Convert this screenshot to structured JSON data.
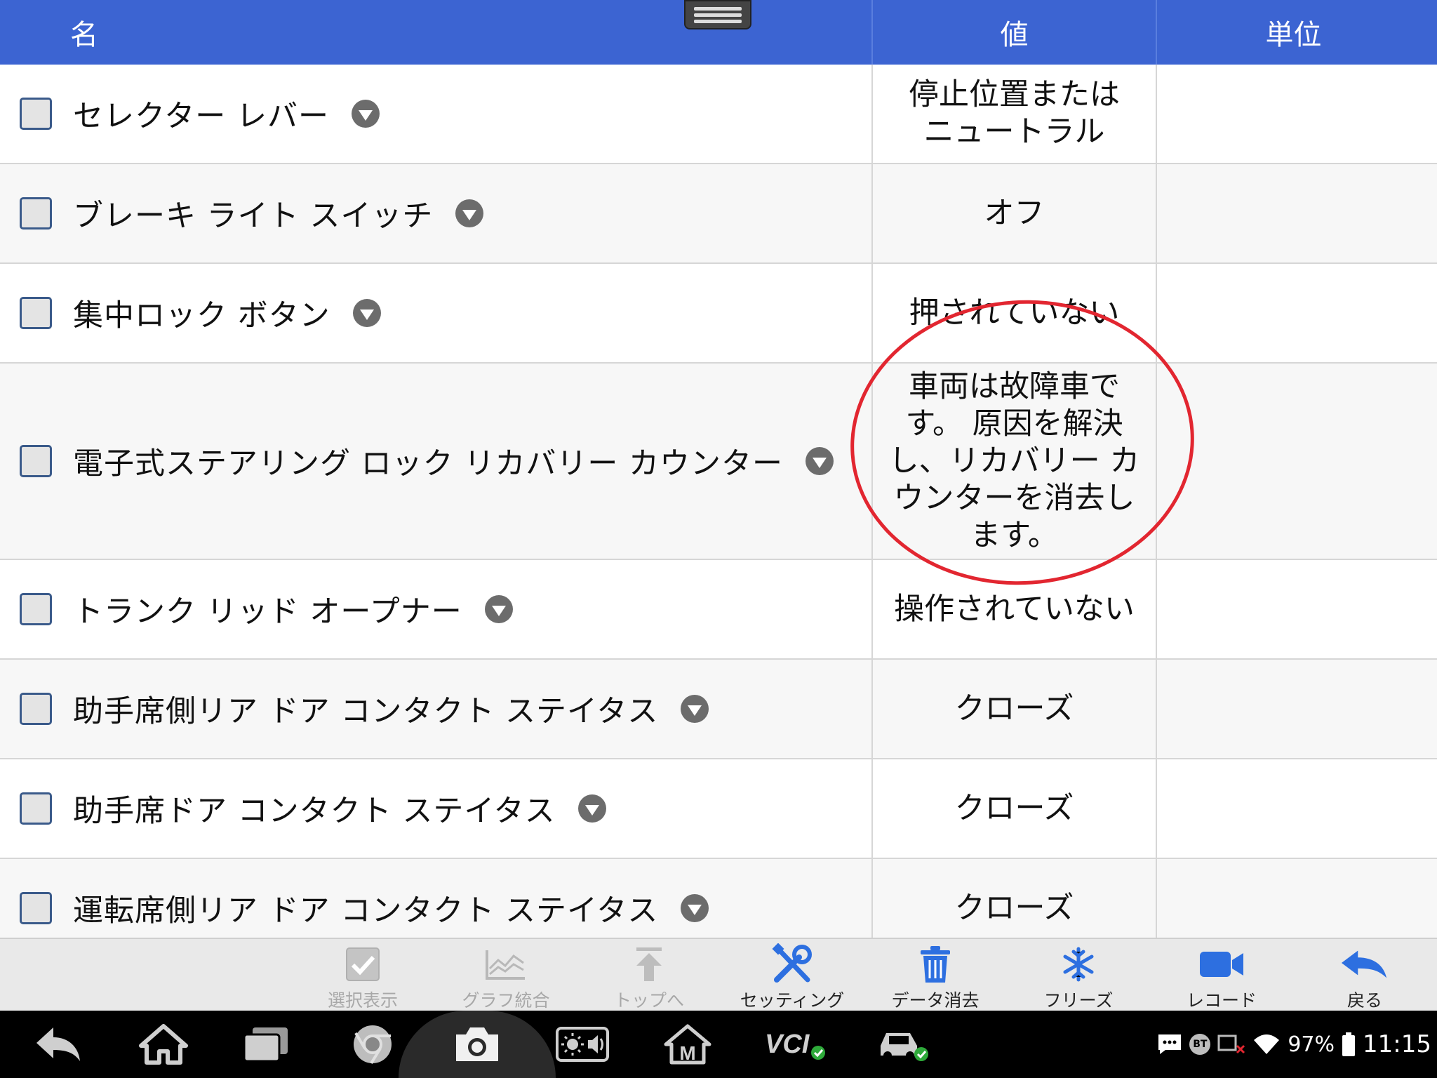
{
  "header": {
    "col_name": "名",
    "col_value": "値",
    "col_unit": "単位"
  },
  "rows": [
    {
      "name": "セレクター レバー",
      "value": "停止位置またはニュートラル",
      "unit": ""
    },
    {
      "name": "ブレーキ ライト スイッチ",
      "value": "オフ",
      "unit": ""
    },
    {
      "name": "集中ロック ボタン",
      "value": "押されていない",
      "unit": ""
    },
    {
      "name": "電子式ステアリング ロック リカバリー カウンター",
      "value": "車両は故障車です。 原因を解決し、リカバリー カウンターを消去します。",
      "unit": ""
    },
    {
      "name": "トランク リッド オープナー",
      "value": "操作されていない",
      "unit": ""
    },
    {
      "name": "助手席側リア ドア コンタクト ステイタス",
      "value": "クローズ",
      "unit": ""
    },
    {
      "name": "助手席ドア コンタクト ステイタス",
      "value": "クローズ",
      "unit": ""
    },
    {
      "name": "運転席側リア ドア コンタクト ステイタス",
      "value": "クローズ",
      "unit": ""
    }
  ],
  "toolbar": {
    "select_display": "選択表示",
    "graph_merge": "グラフ統合",
    "to_top": "トップへ",
    "setting": "セッティング",
    "clear_data": "データ消去",
    "freeze": "フリーズ",
    "record": "レコード",
    "back": "戻る"
  },
  "navbar": {
    "vci_label": "VCI",
    "m_label": "M"
  },
  "status": {
    "bt": "BT",
    "battery": "97%",
    "time": "11:15"
  },
  "colors": {
    "header_bg": "#3c64d2",
    "accent_blue": "#2d6fe0",
    "annotation_red": "#e22630"
  }
}
